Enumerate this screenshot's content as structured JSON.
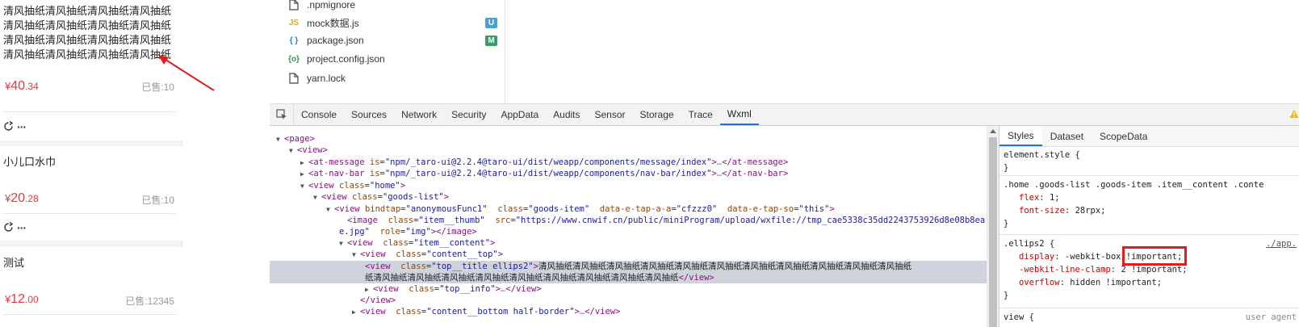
{
  "phone": {
    "items": [
      {
        "title": "清风抽纸清风抽纸清风抽纸清风抽纸清风抽纸清风抽纸清风抽纸清风抽纸清风抽纸清风抽纸清风抽纸清风抽纸清风抽纸清风抽纸清风抽纸清风抽纸清风抽纸",
        "price_symbol": "¥",
        "price_int": "40",
        "price_dec": ".34",
        "sold": "已售:10"
      },
      {
        "title": "小儿口水巾",
        "price_symbol": "¥",
        "price_int": "20",
        "price_dec": ".28",
        "sold": "已售:10"
      },
      {
        "title": "测试",
        "price_symbol": "¥",
        "price_int": "12",
        "price_dec": ".00",
        "sold": "已售:12345"
      }
    ],
    "more_label": "···"
  },
  "file_tree": [
    {
      "name": ".npmignore",
      "icon": "file-icon"
    },
    {
      "name": "mock数据.js",
      "icon": "js-icon",
      "badge": "U",
      "badge_color": "#4aa0d5"
    },
    {
      "name": "package.json",
      "icon": "json-braces-icon",
      "badge": "M",
      "badge_color": "#3a9a6a"
    },
    {
      "name": "project.config.json",
      "icon": "config-icon"
    },
    {
      "name": "yarn.lock",
      "icon": "file-icon"
    }
  ],
  "devtools_tabs": [
    "Console",
    "Sources",
    "Network",
    "Security",
    "AppData",
    "Audits",
    "Sensor",
    "Storage",
    "Trace",
    "Wxml"
  ],
  "active_tab": "Wxml",
  "wxml": {
    "page_tag": "<page>",
    "view_tag": "<view>",
    "at_message": {
      "tag": "at-message",
      "attr": "is",
      "value": "\"npm/_taro-ui@2.2.4@taro-ui/dist/weapp/components/message/index\"",
      "close": "</at-message>"
    },
    "at_nav_bar": {
      "tag": "at-nav-bar",
      "attr": "is",
      "value": "\"npm/_taro-ui@2.2.4@taro-ui/dist/weapp/components/nav-bar/index\"",
      "close": "</at-nav-bar>"
    },
    "home": {
      "tag": "view",
      "attr": "class",
      "value": "\"home\""
    },
    "goods_list": {
      "tag": "view",
      "attr": "class",
      "value": "\"goods-list\""
    },
    "goods_item": {
      "tag": "view",
      "a1": "bindtap",
      "v1": "\"anonymousFunc1\"",
      "a2": "class",
      "v2": "\"goods-item\"",
      "a3": "data-e-tap-a-a",
      "v3": "\"cfzzz0\"",
      "a4": "data-e-tap-so",
      "v4": "\"this\""
    },
    "image": {
      "tag": "image",
      "a1": "class",
      "v1": "\"item__thumb\"",
      "a2": "src",
      "v2": "\"https://www.cnwif.cn/public/miniProgram/upload/wxfile://tmp_cae5338c35dd2243753926d8e08b8ea",
      "v2_cont": "e.jpg\"",
      "a3": "role",
      "v3": "\"img\"",
      "close": "</image>"
    },
    "item_content": {
      "tag": "view",
      "attr": "class",
      "value": "\"item__content\""
    },
    "content_top": {
      "tag": "view",
      "attr": "class",
      "value": "\"content__top\""
    },
    "top_title": {
      "tag": "view",
      "attr": "class",
      "value": "\"top__title ellips2\"",
      "text_line1": "清风抽纸清风抽纸清风抽纸清风抽纸清风抽纸清风抽纸清风抽纸清风抽纸清风抽纸清风抽纸清风抽纸",
      "text_line2": "纸清风抽纸清风抽纸清风抽纸清风抽纸清风抽纸清风抽纸清风抽纸清风抽纸清风抽纸",
      "close": "</view>"
    },
    "top_info": {
      "tag": "view",
      "attr": "class",
      "value": "\"top__info\"",
      "close": "</view>"
    },
    "close_view": "</view>",
    "content_bottom": {
      "tag": "view",
      "attr": "class",
      "value": "\"content__bottom half-border\"",
      "close": "</view>"
    },
    "ellipsis": "…"
  },
  "styles_panel": {
    "tabs": [
      "Styles",
      "Dataset",
      "ScopeData"
    ],
    "active_tab": "Styles",
    "element_style": "element.style {",
    "rule1": {
      "selector": ".home .goods-list .goods-item .item__content .conte",
      "props": [
        {
          "name": "flex",
          "value": "1;"
        },
        {
          "name": "font-size",
          "value": "28rpx;"
        }
      ]
    },
    "rule2": {
      "selector": ".ellips2 {",
      "source": "./app.",
      "props": [
        {
          "name": "display",
          "value": "-webkit-box !important;"
        },
        {
          "name": "-webkit-line-clamp",
          "value": "2 !important;"
        },
        {
          "name": "overflow",
          "value": "hidden !important;"
        }
      ]
    },
    "rule3": {
      "selector": "view {",
      "source": "user agent"
    },
    "close_brace": "}"
  },
  "colors": {
    "price_red": "#e4393c",
    "active_tab_blue": "#1a73e8",
    "annotation_red": "#e31b1b"
  }
}
